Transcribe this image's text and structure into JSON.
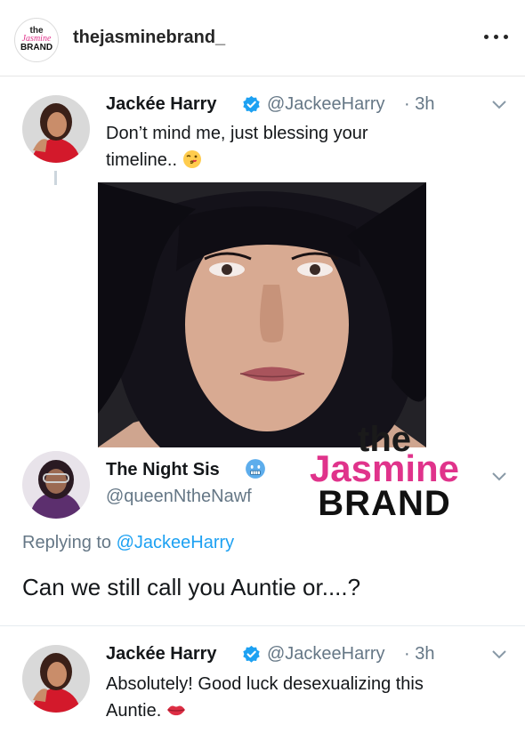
{
  "instagram": {
    "avatar_lines": [
      "the",
      "Jasmine",
      "BRAND"
    ],
    "username": "thejasminebrand_"
  },
  "tweet1": {
    "name": "Jackée Harry",
    "handle": "@JackeeHarry",
    "time": "· 3h",
    "text_line1": "Don’t mind me, just blessing your",
    "text_line2": "timeline..",
    "emoji": "kiss-wink-emoji"
  },
  "watermark": {
    "the": "the",
    "jasmine": "Jasmine",
    "brand": "BRAND"
  },
  "reply": {
    "name": "The Night Sis",
    "handle": "@queenNtheNawf",
    "emoji": "cold-face-emoji",
    "replying_label": "Replying to",
    "replying_to": "@JackeeHarry",
    "text": "Can we still call you Auntie or....?"
  },
  "tweet2": {
    "name": "Jackée Harry",
    "handle": "@JackeeHarry",
    "time": "· 3h",
    "text_line1": "Absolutely! Good luck desexualizing this",
    "text_line2": "Auntie.",
    "emoji": "lips-emoji"
  },
  "colors": {
    "twitter_blue": "#1da1f2",
    "handle_gray": "#657786",
    "brand_pink": "#e0338b"
  }
}
